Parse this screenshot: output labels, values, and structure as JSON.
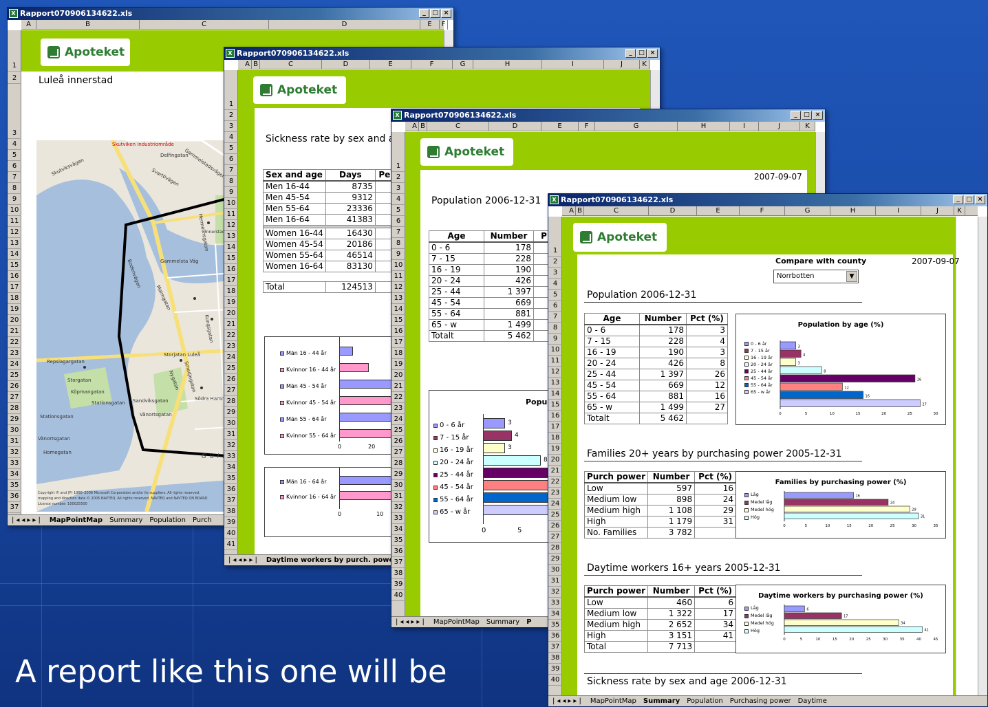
{
  "win1": {
    "title": "Rapport070906134622.xls",
    "cols": [
      "A",
      "B",
      "C",
      "D",
      "E",
      "F"
    ],
    "rows": [
      "1",
      "2",
      "3",
      "4",
      "5",
      "6",
      "7",
      "8",
      "9",
      "10",
      "11",
      "12",
      "13",
      "14",
      "15",
      "16",
      "17",
      "18",
      "19",
      "20",
      "21",
      "22",
      "23",
      "24",
      "25",
      "26",
      "27",
      "28",
      "29",
      "30",
      "31",
      "32",
      "33",
      "34",
      "35",
      "36",
      "37"
    ],
    "logo": "Apoteket",
    "location": "Luleå innerstad",
    "map_labels": [
      "Skutviken industriområde",
      "Delfingatan",
      "Skutviksvägen",
      "Gammelstadsvägen",
      "Svartövägen",
      "Gammelsta Väg",
      "Innerstadens Kyrkogård",
      "Bodenvägen",
      "Hermelinsgatan",
      "Malmgatan",
      "Kungsgatan",
      "Repslagargatan",
      "Storgatan",
      "Köpmangatan",
      "Stationsgatan",
      "Sandviksgatan",
      "Vänortsgatan",
      "Storjatan Luleå",
      "Nygatan",
      "Smedjegatan",
      "Södra Hamnleden",
      "Stationsgatan",
      "Vänortsgatan",
      "Homegatan",
      "Gulf of Bothnia"
    ],
    "copyright": [
      "Copyright ® and (P) 1988–2006 Microsoft Corporation and/or its suppliers. All rights reserved.",
      "mapping and direction data © 2005 NAVTEQ. All rights reserved. NAVTEQ and NAVTEQ ON BOARD",
      "License number: 100025500"
    ],
    "tabs": [
      "MapPointMap",
      "Summary",
      "Population",
      "Purch"
    ]
  },
  "win2": {
    "title": "Rapport070906134622.xls",
    "cols": [
      "A",
      "B",
      "C",
      "D",
      "E",
      "F",
      "G",
      "H",
      "I",
      "J",
      "K"
    ],
    "rows": [
      "1",
      "2",
      "3",
      "4",
      "5",
      "6",
      "7",
      "8",
      "9",
      "10",
      "11",
      "12",
      "13",
      "14",
      "15",
      "16",
      "17",
      "18",
      "19",
      "20",
      "21",
      "22",
      "23",
      "24",
      "25",
      "26",
      "27",
      "28",
      "29",
      "30",
      "31",
      "32",
      "33",
      "34",
      "35",
      "36",
      "37",
      "38",
      "39",
      "40",
      "41"
    ],
    "logo": "Apoteket",
    "heading": "Sickness rate by sex and age",
    "table": {
      "headers": [
        "Sex and age",
        "Days",
        "Pers"
      ],
      "rows": [
        [
          "Men 16-44",
          "8735"
        ],
        [
          "Men 45-54",
          "9312"
        ],
        [
          "Men 55-64",
          "23336"
        ],
        [
          "Men 16-64",
          "41383"
        ],
        [
          "Women 16-44",
          "16430"
        ],
        [
          "Women 45-54",
          "20186"
        ],
        [
          "Women 55-64",
          "46514"
        ],
        [
          "Women 16-64",
          "83130"
        ],
        [
          "Total",
          "124513"
        ]
      ]
    },
    "chart1_legend": [
      "Män 16 - 44 år",
      "Kvinnor 16 - 44 år",
      "Män 45 - 54 år",
      "Kvinnor 45 - 54 år",
      "Män 55 - 64 år",
      "Kvinnor 55 - 64 år"
    ],
    "chart1_ticks": [
      "0",
      "20"
    ],
    "chart2_legend": [
      "Män 16 - 64 år",
      "Kvinnor 16 - 64 år"
    ],
    "chart2_ticks": [
      "0",
      "10"
    ],
    "tabs": [
      "Daytime workers by purch. power"
    ]
  },
  "win3": {
    "title": "Rapport070906134622.xls",
    "cols": [
      "A",
      "B",
      "C",
      "D",
      "E",
      "F",
      "G",
      "H",
      "I",
      "J",
      "K"
    ],
    "rows": [
      "1",
      "2",
      "3",
      "4",
      "5",
      "6",
      "7",
      "8",
      "9",
      "10",
      "11",
      "12",
      "13",
      "14",
      "15",
      "16",
      "17",
      "18",
      "19",
      "20",
      "21",
      "22",
      "23",
      "24",
      "25",
      "26",
      "27",
      "28",
      "29",
      "30",
      "31",
      "32",
      "33",
      "34",
      "35",
      "36",
      "37",
      "38",
      "39",
      "40"
    ],
    "logo": "Apoteket",
    "date": "2007-09-07",
    "heading": "Population  2006-12-31",
    "table": {
      "headers": [
        "Age",
        "Number",
        "P"
      ],
      "rows": [
        [
          "0 -  6",
          "178"
        ],
        [
          "7 - 15",
          "228"
        ],
        [
          "16 - 19",
          "190"
        ],
        [
          "20 - 24",
          "426"
        ],
        [
          "25 - 44",
          "1 397"
        ],
        [
          "45 - 54",
          "669"
        ],
        [
          "55 - 64",
          "881"
        ],
        [
          "65 -  w",
          "1 499"
        ],
        [
          "Totalt",
          "5 462"
        ]
      ]
    },
    "chart_title": "Popul",
    "chart_legend": [
      "0 - 6 år",
      "7 - 15 år",
      "16 - 19 år",
      "20 - 24 år",
      "25 - 44 år",
      "45 - 54 år",
      "55 - 64 år",
      "65 - w år"
    ],
    "chart_labels": [
      "3",
      "4",
      "3",
      "8"
    ],
    "chart_ticks": [
      "0",
      "5"
    ],
    "tabs": [
      "MapPointMap",
      "Summary",
      "P"
    ]
  },
  "win4": {
    "title": "Rapport070906134622.xls",
    "cols": [
      "A",
      "B",
      "C",
      "D",
      "E",
      "F",
      "G",
      "H",
      "I",
      "J",
      "K"
    ],
    "rows": [
      "1",
      "2",
      "3",
      "4",
      "5",
      "6",
      "7",
      "8",
      "9",
      "10",
      "11",
      "12",
      "13",
      "14",
      "15",
      "16",
      "17",
      "18",
      "19",
      "20",
      "21",
      "22",
      "23",
      "24",
      "25",
      "26",
      "27",
      "28",
      "29",
      "30",
      "31",
      "32",
      "33",
      "34",
      "35",
      "36",
      "37",
      "38",
      "39",
      "40"
    ],
    "logo": "Apoteket",
    "compare_label": "Compare with county",
    "county_select": "Norrbotten",
    "date": "2007-09-07",
    "population": {
      "heading": "Population  2006-12-31",
      "headers": [
        "Age",
        "Number",
        "Pct (%)"
      ],
      "rows": [
        [
          "0 -  6",
          "178",
          "3"
        ],
        [
          "7 - 15",
          "228",
          "4"
        ],
        [
          "16 - 19",
          "190",
          "3"
        ],
        [
          "20 - 24",
          "426",
          "8"
        ],
        [
          "25 - 44",
          "1 397",
          "26"
        ],
        [
          "45 - 54",
          "669",
          "12"
        ],
        [
          "55 - 64",
          "881",
          "16"
        ],
        [
          "65 -  w",
          "1 499",
          "27"
        ],
        [
          "Totalt",
          "5 462",
          ""
        ]
      ],
      "chart_title": "Population by age (%)",
      "legend": [
        "0 - 6 år",
        "7 - 15 år",
        "16 - 19 år",
        "20 - 24 år",
        "25 - 44 år",
        "45 - 54 år",
        "55 - 64 år",
        "65 - w år"
      ],
      "ticks": [
        "0",
        "5",
        "10",
        "15",
        "20",
        "25",
        "30"
      ]
    },
    "families": {
      "heading": "Families 20+ years by purchasing power  2005-12-31",
      "headers": [
        "Purch power",
        "Number",
        "Pct (%)"
      ],
      "rows": [
        [
          "Low",
          "597",
          "16"
        ],
        [
          "Medium low",
          "898",
          "24"
        ],
        [
          "Medium high",
          "1 108",
          "29"
        ],
        [
          "High",
          "1 179",
          "31"
        ],
        [
          "No. Families",
          "3 782",
          ""
        ]
      ],
      "chart_title": "Families by purchasing power (%)",
      "legend": [
        "Låg",
        "Medel låg",
        "Medel hög",
        "Hög"
      ],
      "ticks": [
        "0",
        "5",
        "10",
        "15",
        "20",
        "25",
        "30",
        "35"
      ]
    },
    "daytime": {
      "heading": "Daytime workers 16+ years 2005-12-31",
      "headers": [
        "Purch power",
        "Number",
        "Pct (%)"
      ],
      "rows": [
        [
          "Low",
          "460",
          "6"
        ],
        [
          "Medium low",
          "1 322",
          "17"
        ],
        [
          "Medium high",
          "2 652",
          "34"
        ],
        [
          "High",
          "3 151",
          "41"
        ],
        [
          "Total",
          "7 713",
          ""
        ]
      ],
      "chart_title": "Daytime workers by purchasing power (%)",
      "legend": [
        "Låg",
        "Medel låg",
        "Medel hög",
        "Hög"
      ],
      "ticks": [
        "0",
        "5",
        "10",
        "15",
        "20",
        "25",
        "30",
        "35",
        "40",
        "45"
      ]
    },
    "sickness_heading": "Sickness rate by sex and age  2006-12-31",
    "tabs": [
      "MapPointMap",
      "Summary",
      "Population",
      "Purchasing power",
      "Daytime"
    ]
  },
  "chart_data": [
    {
      "type": "bar",
      "title": "Population by age (%)",
      "categories": [
        "0 - 6 år",
        "7 - 15 år",
        "16 - 19 år",
        "20 - 24 år",
        "25 - 44 år",
        "45 - 54 år",
        "55 - 64 år",
        "65 - w år"
      ],
      "values": [
        3,
        4,
        3,
        8,
        26,
        12,
        16,
        27
      ],
      "xlim": [
        0,
        30
      ],
      "colors": [
        "#9999ff",
        "#993366",
        "#ffffcc",
        "#ccffff",
        "#660066",
        "#ff8080",
        "#0066cc",
        "#ccccff"
      ]
    },
    {
      "type": "bar",
      "title": "Families by purchasing power (%)",
      "categories": [
        "Låg",
        "Medel låg",
        "Medel hög",
        "Hög"
      ],
      "values": [
        16,
        24,
        29,
        31
      ],
      "xlim": [
        0,
        35
      ],
      "colors": [
        "#9999ff",
        "#993366",
        "#ffffcc",
        "#ccffff"
      ]
    },
    {
      "type": "bar",
      "title": "Daytime workers by purchasing power (%)",
      "categories": [
        "Låg",
        "Medel låg",
        "Medel hög",
        "Hög"
      ],
      "values": [
        6,
        17,
        34,
        41
      ],
      "xlim": [
        0,
        45
      ],
      "colors": [
        "#9999ff",
        "#993366",
        "#ffffcc",
        "#ccffff"
      ]
    }
  ],
  "caption": "A report like this one will be"
}
